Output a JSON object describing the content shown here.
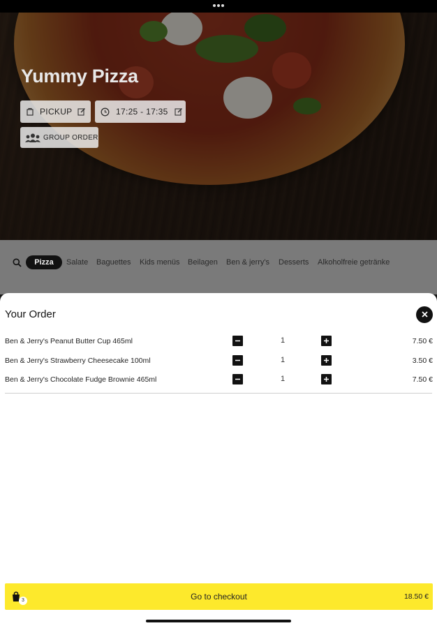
{
  "restaurant": {
    "name": "Yummy Pizza"
  },
  "hero_chips": {
    "pickup_label": "PICKUP",
    "time_label": "17:25 - 17:35",
    "group_label": "GROUP ORDER"
  },
  "categories": {
    "active": "Pizza",
    "items": [
      "Salate",
      "Baguettes",
      "Kids menüs",
      "Beilagen",
      "Ben & jerry's",
      "Desserts",
      "Alkoholfreie getränke"
    ]
  },
  "order": {
    "title": "Your Order",
    "items": [
      {
        "name": "Ben & Jerry's Peanut Butter Cup 465ml",
        "qty": "1",
        "price": "7.50 €"
      },
      {
        "name": "Ben & Jerry's Strawberry Cheesecake 100ml",
        "qty": "1",
        "price": "3.50 €"
      },
      {
        "name": "Ben & Jerry's Chocolate Fudge Brownie 465ml",
        "qty": "1",
        "price": "7.50 €"
      }
    ]
  },
  "checkout": {
    "label": "Go to checkout",
    "total": "18.50 €",
    "cart_count": "3"
  },
  "colors": {
    "accent": "#fde92c",
    "dark": "#111111",
    "category_bar": "#7a7a7a"
  },
  "icons": {
    "pickup": "bag-icon",
    "time": "clock-icon",
    "edit": "edit-icon",
    "group": "group-icon",
    "search": "search-icon",
    "close": "close-icon",
    "minus": "minus-icon",
    "plus": "plus-icon",
    "cart": "shopping-bag-icon"
  }
}
